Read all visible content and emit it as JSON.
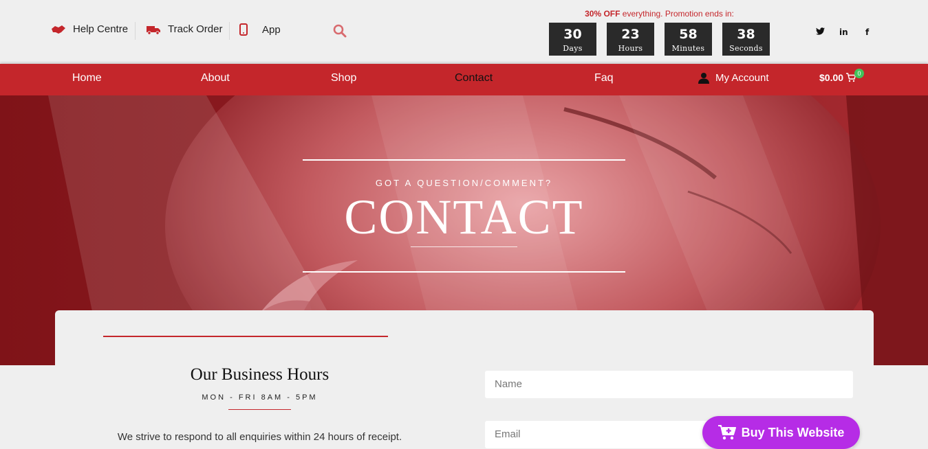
{
  "topbar": {
    "help_label": "Help Centre",
    "track_label": "Track Order",
    "app_label": "App"
  },
  "promo": {
    "bold": "30% OFF",
    "text": " everything. Promotion ends in:",
    "countdown": [
      {
        "value": "30",
        "label": "Days"
      },
      {
        "value": "23",
        "label": "Hours"
      },
      {
        "value": "58",
        "label": "Minutes"
      },
      {
        "value": "38",
        "label": "Seconds"
      }
    ]
  },
  "social": {
    "twitter": "𝕥",
    "linkedin": "in",
    "facebook": "f"
  },
  "nav": {
    "items": [
      "Home",
      "About",
      "Shop",
      "Contact",
      "Faq"
    ],
    "active": "Contact",
    "account_label": "My Account",
    "cart_total": "$0.00",
    "cart_count": "0"
  },
  "hero": {
    "subtitle": "GOT A QUESTION/COMMENT?",
    "title": "CONTACT"
  },
  "business": {
    "title": "Our Business Hours",
    "hours": "MON - FRI 8AM - 5PM",
    "text": "We strive to respond to all enquiries within 24 hours of receipt."
  },
  "form": {
    "name_placeholder": "Name",
    "email_placeholder": "Email"
  },
  "buy_button": "Buy This Website",
  "colors": {
    "brand": "#c4262b",
    "buy": "#b62ce6",
    "countdown_bg": "#2a2a2a"
  }
}
